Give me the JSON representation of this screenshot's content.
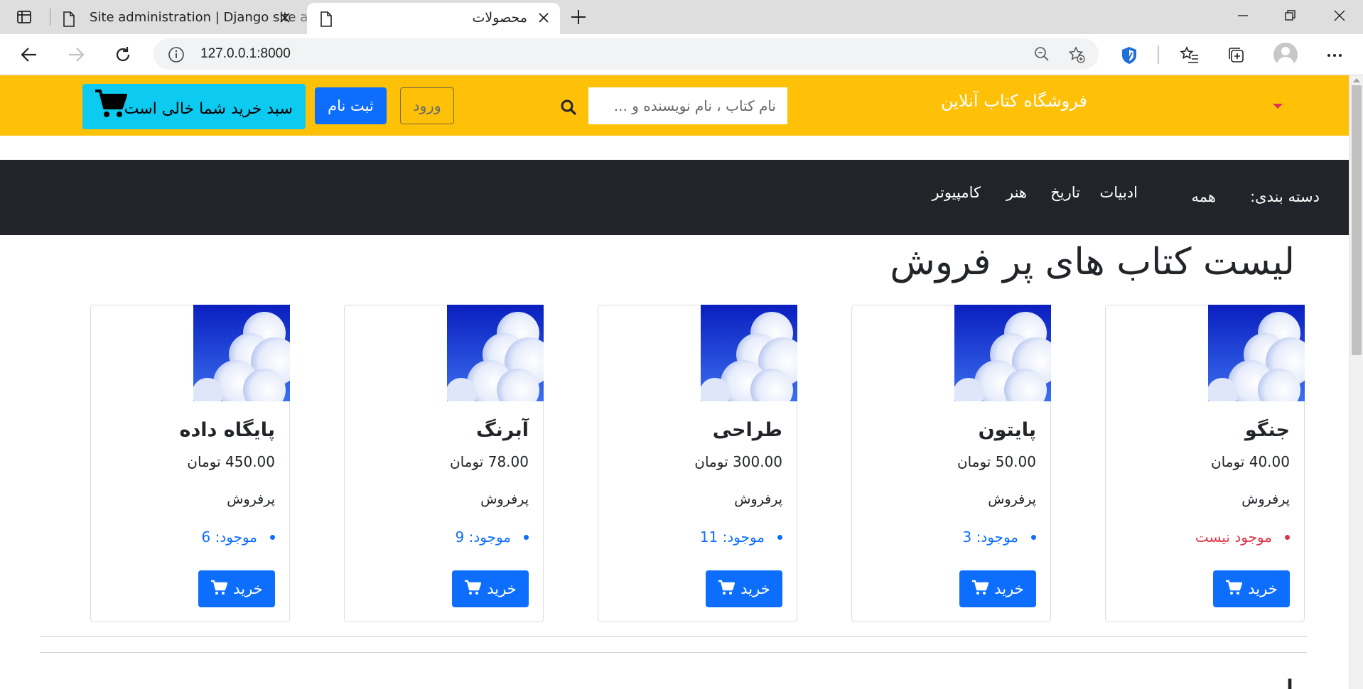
{
  "browser": {
    "tabs": [
      {
        "title": "Site administration | Django site admin",
        "active": false
      },
      {
        "title": "محصولات",
        "active": true
      }
    ],
    "url": "127.0.0.1:8000"
  },
  "header": {
    "brand": "فروشگاه کتاب آنلاین",
    "search_placeholder": "نام کتاب ، نام نویسنده و ...",
    "login_label": "ورود",
    "signup_label": "ثبت نام",
    "cart_label": "سبد خرید شما خالی است",
    "colors": {
      "bar": "#ffc107",
      "cart": "#0dcaf0",
      "primary": "#0d6efd"
    }
  },
  "categories": {
    "label": "دسته بندی:",
    "items": [
      "همه",
      "ادبیات",
      "تاریخ",
      "هنر",
      "کامپیوتر"
    ]
  },
  "section": {
    "title": "لیست کتاب های پر فروش",
    "next_title_partial": "ل"
  },
  "products": [
    {
      "name": "پایگاه داده",
      "price": "450.00 تومان",
      "tag": "پرفروش",
      "stock": "موجود: 6",
      "in_stock": true,
      "buy_label": "خرید"
    },
    {
      "name": "آبرنگ",
      "price": "78.00 تومان",
      "tag": "پرفروش",
      "stock": "موجود: 9",
      "in_stock": true,
      "buy_label": "خرید"
    },
    {
      "name": "طراحی",
      "price": "300.00 تومان",
      "tag": "پرفروش",
      "stock": "موجود: 11",
      "in_stock": true,
      "buy_label": "خرید"
    },
    {
      "name": "پایتون",
      "price": "50.00 تومان",
      "tag": "پرفروش",
      "stock": "موجود: 3",
      "in_stock": true,
      "buy_label": "خرید"
    },
    {
      "name": "جنگو",
      "price": "40.00 تومان",
      "tag": "پرفروش",
      "stock": "موجود نیست",
      "in_stock": false,
      "buy_label": "خرید"
    }
  ],
  "status_colors": {
    "in_stock": "#0d6efd",
    "out_of_stock": "#dc3545"
  }
}
